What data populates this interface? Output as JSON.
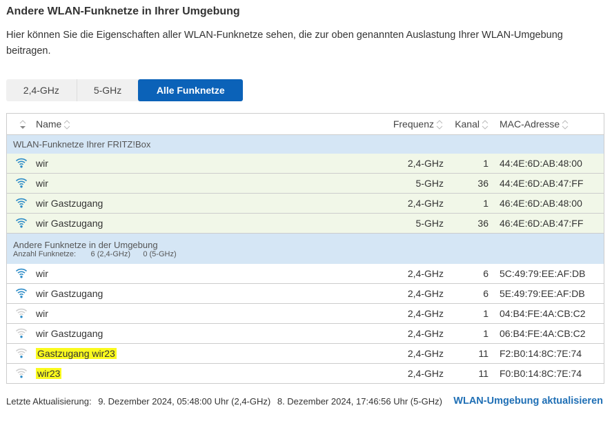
{
  "title": "Andere WLAN-Funknetze in Ihrer Umgebung",
  "description": "Hier können Sie die Eigenschaften aller WLAN-Funknetze sehen, die zur oben genannten Auslastung Ihrer WLAN-Umgebung beitragen.",
  "tabs": [
    {
      "label": "2,4-GHz",
      "active": false
    },
    {
      "label": "5-GHz",
      "active": false
    },
    {
      "label": "Alle Funknetze",
      "active": true
    }
  ],
  "columns": {
    "name": "Name",
    "freq": "Frequenz",
    "kanal": "Kanal",
    "mac": "MAC-Adresse"
  },
  "colors": {
    "accent": "#0b62b8",
    "signal": "#2a8ac6",
    "signal_off": "#cfcfcf",
    "highlight": "#fafa1e",
    "own_row": "#f1f7e8",
    "group_row": "#d5e6f5"
  },
  "groups": [
    {
      "label": "WLAN-Funknetze Ihrer FRITZ!Box",
      "own": true,
      "rows": [
        {
          "name": "wir",
          "freq": "2,4-GHz",
          "kanal": "1",
          "mac": "44:4E:6D:AB:48:00",
          "signal": 4
        },
        {
          "name": "wir",
          "freq": "5-GHz",
          "kanal": "36",
          "mac": "44:4E:6D:AB:47:FF",
          "signal": 4
        },
        {
          "name": "wir Gastzugang",
          "freq": "2,4-GHz",
          "kanal": "1",
          "mac": "46:4E:6D:AB:48:00",
          "signal": 4
        },
        {
          "name": "wir Gastzugang",
          "freq": "5-GHz",
          "kanal": "36",
          "mac": "46:4E:6D:AB:47:FF",
          "signal": 4
        }
      ]
    },
    {
      "label": "Andere Funknetze in der Umgebung",
      "own": false,
      "count_label": "Anzahl Funknetze:",
      "count_24": "6 (2,4-GHz)",
      "count_5": "0 (5-GHz)",
      "rows": [
        {
          "name": "wir",
          "freq": "2,4-GHz",
          "kanal": "6",
          "mac": "5C:49:79:EE:AF:DB",
          "signal": 4
        },
        {
          "name": "wir Gastzugang",
          "freq": "2,4-GHz",
          "kanal": "6",
          "mac": "5E:49:79:EE:AF:DB",
          "signal": 4
        },
        {
          "name": "wir",
          "freq": "2,4-GHz",
          "kanal": "1",
          "mac": "04:B4:FE:4A:CB:C2",
          "signal": 1
        },
        {
          "name": "wir Gastzugang",
          "freq": "2,4-GHz",
          "kanal": "1",
          "mac": "06:B4:FE:4A:CB:C2",
          "signal": 1
        },
        {
          "name": "Gastzugang wir23",
          "freq": "2,4-GHz",
          "kanal": "11",
          "mac": "F2:B0:14:8C:7E:74",
          "signal": 1,
          "highlighted": true
        },
        {
          "name": "wir23",
          "freq": "2,4-GHz",
          "kanal": "11",
          "mac": "F0:B0:14:8C:7E:74",
          "signal": 0,
          "highlighted": true
        }
      ]
    }
  ],
  "footer": {
    "label": "Letzte Aktualisierung:",
    "time_24": "9. Dezember 2024, 05:48:00 Uhr (2,4-GHz)",
    "time_5": "8. Dezember 2024, 17:46:56 Uhr (5-GHz)",
    "refresh": "WLAN-Umgebung aktualisieren"
  }
}
